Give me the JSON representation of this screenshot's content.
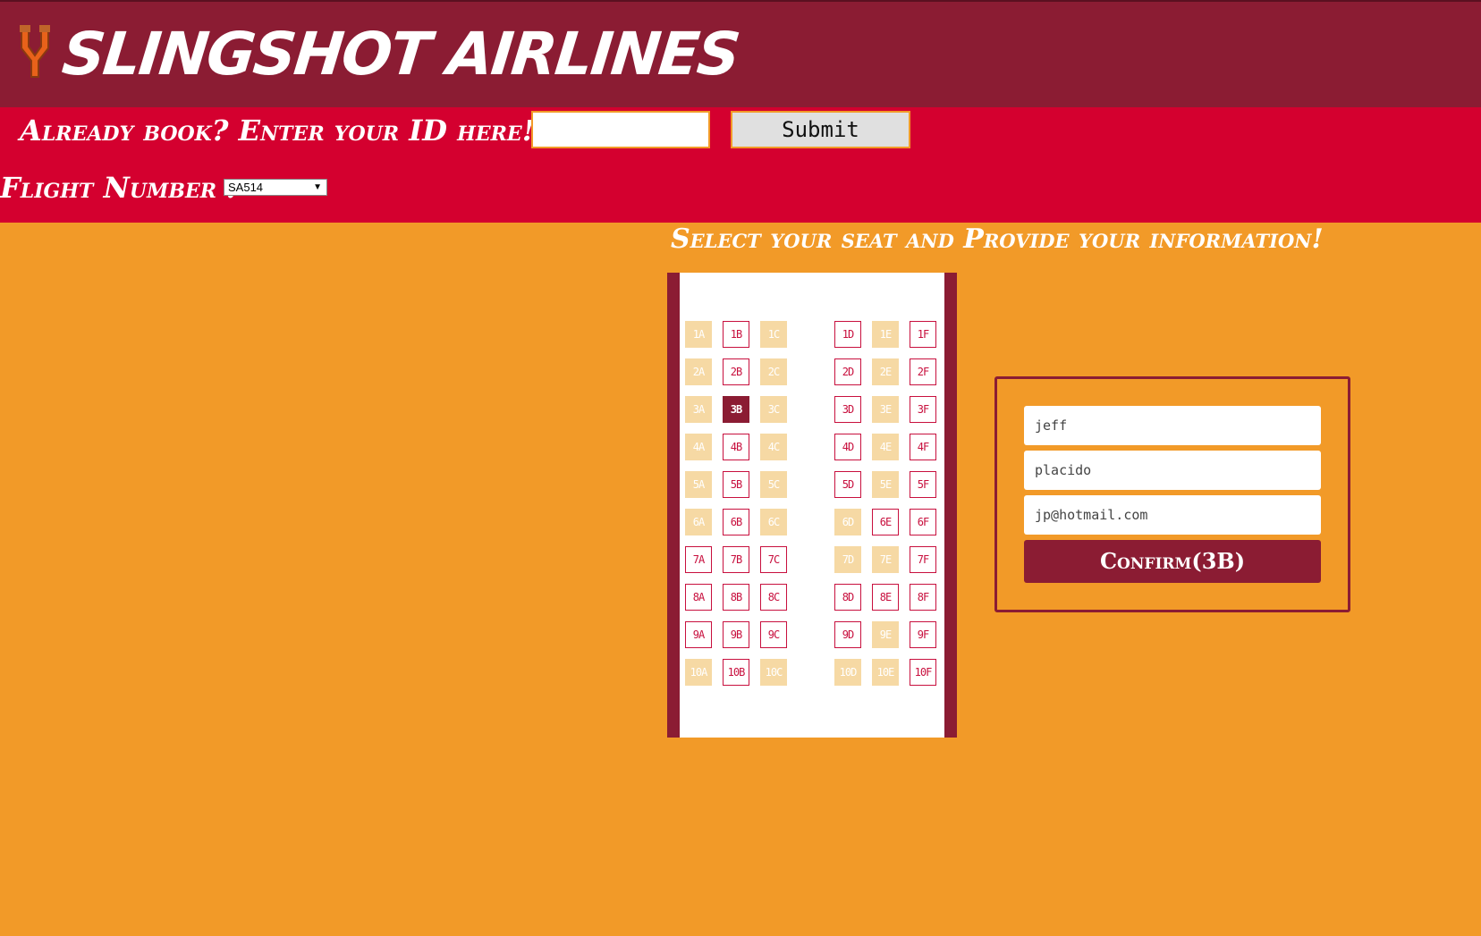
{
  "header": {
    "brand": "Slingshot Airlines",
    "logo_icon": "slingshot-icon"
  },
  "lookup": {
    "label": "Already book? Enter your ID here!",
    "id_value": "",
    "submit_label": "Submit"
  },
  "flight": {
    "label": "Flight Number :",
    "selected": "SA514"
  },
  "seating": {
    "title": "Select your seat and Provide your information!",
    "rows": [
      [
        {
          "id": "1A",
          "state": "taken"
        },
        {
          "id": "1B",
          "state": "available"
        },
        {
          "id": "1C",
          "state": "taken"
        },
        {
          "id": "1D",
          "state": "available"
        },
        {
          "id": "1E",
          "state": "taken"
        },
        {
          "id": "1F",
          "state": "available"
        }
      ],
      [
        {
          "id": "2A",
          "state": "taken"
        },
        {
          "id": "2B",
          "state": "available"
        },
        {
          "id": "2C",
          "state": "taken"
        },
        {
          "id": "2D",
          "state": "available"
        },
        {
          "id": "2E",
          "state": "taken"
        },
        {
          "id": "2F",
          "state": "available"
        }
      ],
      [
        {
          "id": "3A",
          "state": "taken"
        },
        {
          "id": "3B",
          "state": "selected"
        },
        {
          "id": "3C",
          "state": "taken"
        },
        {
          "id": "3D",
          "state": "available"
        },
        {
          "id": "3E",
          "state": "taken"
        },
        {
          "id": "3F",
          "state": "available"
        }
      ],
      [
        {
          "id": "4A",
          "state": "taken"
        },
        {
          "id": "4B",
          "state": "available"
        },
        {
          "id": "4C",
          "state": "taken"
        },
        {
          "id": "4D",
          "state": "available"
        },
        {
          "id": "4E",
          "state": "taken"
        },
        {
          "id": "4F",
          "state": "available"
        }
      ],
      [
        {
          "id": "5A",
          "state": "taken"
        },
        {
          "id": "5B",
          "state": "available"
        },
        {
          "id": "5C",
          "state": "taken"
        },
        {
          "id": "5D",
          "state": "available"
        },
        {
          "id": "5E",
          "state": "taken"
        },
        {
          "id": "5F",
          "state": "available"
        }
      ],
      [
        {
          "id": "6A",
          "state": "taken"
        },
        {
          "id": "6B",
          "state": "available"
        },
        {
          "id": "6C",
          "state": "taken"
        },
        {
          "id": "6D",
          "state": "taken"
        },
        {
          "id": "6E",
          "state": "available"
        },
        {
          "id": "6F",
          "state": "available"
        }
      ],
      [
        {
          "id": "7A",
          "state": "available"
        },
        {
          "id": "7B",
          "state": "available"
        },
        {
          "id": "7C",
          "state": "available"
        },
        {
          "id": "7D",
          "state": "taken"
        },
        {
          "id": "7E",
          "state": "taken"
        },
        {
          "id": "7F",
          "state": "available"
        }
      ],
      [
        {
          "id": "8A",
          "state": "available"
        },
        {
          "id": "8B",
          "state": "available"
        },
        {
          "id": "8C",
          "state": "available"
        },
        {
          "id": "8D",
          "state": "available"
        },
        {
          "id": "8E",
          "state": "available"
        },
        {
          "id": "8F",
          "state": "available"
        }
      ],
      [
        {
          "id": "9A",
          "state": "available"
        },
        {
          "id": "9B",
          "state": "available"
        },
        {
          "id": "9C",
          "state": "available"
        },
        {
          "id": "9D",
          "state": "available"
        },
        {
          "id": "9E",
          "state": "taken"
        },
        {
          "id": "9F",
          "state": "available"
        }
      ],
      [
        {
          "id": "10A",
          "state": "taken"
        },
        {
          "id": "10B",
          "state": "available"
        },
        {
          "id": "10C",
          "state": "taken"
        },
        {
          "id": "10D",
          "state": "taken"
        },
        {
          "id": "10E",
          "state": "taken"
        },
        {
          "id": "10F",
          "state": "available"
        }
      ]
    ]
  },
  "form": {
    "first_name": "jeff",
    "last_name": "placido",
    "email": "jp@hotmail.com",
    "confirm_label": "Confirm(3B)"
  },
  "colors": {
    "header": "#8b1c33",
    "bar": "#d4002f",
    "background": "#f29a28",
    "seat_taken": "#f6d9a4",
    "seat_available_border": "#c8103e"
  }
}
